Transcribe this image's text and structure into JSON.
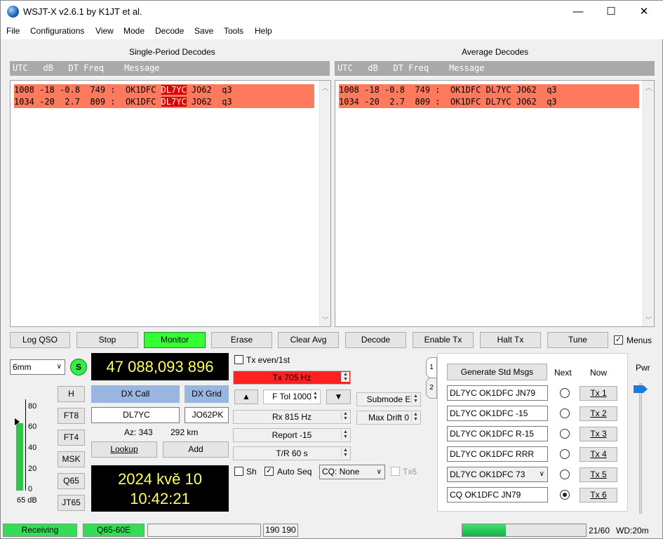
{
  "window": {
    "title": "WSJT-X   v2.6.1   by K1JT et al.",
    "controls": {
      "minimize": "—",
      "maximize": "☐",
      "close": "✕"
    }
  },
  "menu": [
    "File",
    "Configurations",
    "View",
    "Mode",
    "Decode",
    "Save",
    "Tools",
    "Help"
  ],
  "single_period": {
    "title": "Single-Period Decodes",
    "header": "UTC   dB   DT Freq    Message",
    "rows": [
      {
        "pre": "1008 -18 -0.8  749 :  OK1DFC ",
        "call": "DL7YC",
        "post": " JO62  q3"
      },
      {
        "pre": "1034 -20  2.7  809 :  OK1DFC ",
        "call": "DL7YC",
        "post": " JO62  q3"
      }
    ]
  },
  "average": {
    "title": "Average Decodes",
    "header": "UTC   dB   DT Freq    Message",
    "rows": [
      "1008 -18 -0.8  749 :  OK1DFC DL7YC JO62  q3",
      "1034 -20  2.7  809 :  OK1DFC DL7YC JO62  q3"
    ]
  },
  "buttons": {
    "log_qso": "Log QSO",
    "stop": "Stop",
    "monitor": "Monitor",
    "erase": "Erase",
    "clear_avg": "Clear Avg",
    "decode": "Decode",
    "enable_tx": "Enable Tx",
    "halt_tx": "Halt Tx",
    "tune": "Tune",
    "menus": "Menus"
  },
  "band": {
    "value": "6mm",
    "s_label": "S"
  },
  "frequency": "47 088,093 896",
  "level_meter": {
    "ticks": [
      "80",
      "60",
      "40",
      "20",
      "0"
    ],
    "value_label": "65 dB"
  },
  "mode_buttons": [
    "H",
    "FT8",
    "FT4",
    "MSK",
    "Q65",
    "JT65"
  ],
  "dx": {
    "call_label": "DX Call",
    "grid_label": "DX Grid",
    "call_value": "DL7YC",
    "grid_value": "JO62PK",
    "az": "Az: 343",
    "dist": "292 km",
    "lookup": "Lookup",
    "add": "Add"
  },
  "clock": {
    "date": "2024 kvě 10",
    "time": "10:42:21"
  },
  "tx_controls": {
    "tx_even": "Tx even/1st",
    "tx_freq": "Tx  705  Hz",
    "ftol": "F Tol  1000",
    "rx_freq": "Rx  815  Hz",
    "report": "Report  -15",
    "tr": "T/R  60  s",
    "submode": "Submode  E",
    "max_drift": "Max Drift  0",
    "sh": "Sh",
    "auto_seq": "Auto Seq",
    "cq": "CQ: None",
    "tx6": "Tx6"
  },
  "messages": {
    "tab1": "1",
    "tab2": "2",
    "generate": "Generate Std Msgs",
    "next_label": "Next",
    "now_label": "Now",
    "rows": [
      {
        "text": "DL7YC OK1DFC JN79",
        "btn": "Tx 1",
        "selected": false
      },
      {
        "text": "DL7YC OK1DFC -15",
        "btn": "Tx 2",
        "selected": false
      },
      {
        "text": "DL7YC OK1DFC R-15",
        "btn": "Tx 3",
        "selected": false
      },
      {
        "text": "DL7YC OK1DFC RRR",
        "btn": "Tx 4",
        "selected": false
      },
      {
        "text": "DL7YC OK1DFC 73",
        "btn": "Tx 5",
        "selected": false
      },
      {
        "text": "CQ OK1DFC JN79",
        "btn": "Tx 6",
        "selected": true
      }
    ]
  },
  "pwr": {
    "label": "Pwr"
  },
  "status": {
    "receiving": "Receiving",
    "mode": "Q65-60E",
    "numbers": "190  190",
    "progress_fraction": 0.35,
    "counter": "21/60",
    "wd": "WD:20m"
  },
  "colors": {
    "decode_bg": "#ff7a5c",
    "call_highlight": "#e00000",
    "monitor_green": "#33ff33",
    "tx_red": "#ff2020",
    "status_green": "#33dd55"
  }
}
